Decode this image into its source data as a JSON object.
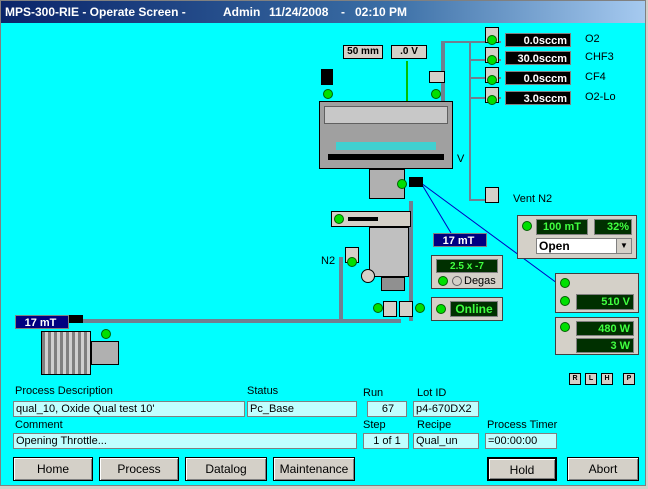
{
  "window": {
    "title_app": "MPS-300-RIE - Operate Screen -",
    "title_user": "Admin",
    "title_date": "11/24/2008",
    "title_sep": "-",
    "title_time": "02:10 PM"
  },
  "chamber": {
    "gap_value": "50 mm",
    "voltage_value": ".0 V",
    "side_label": "V",
    "pressure_readout": "17 mT",
    "n2_label": "N2",
    "pump_pressure": "17 mT"
  },
  "gases": [
    {
      "flow": "0.0sccm",
      "name": "O2"
    },
    {
      "flow": "30.0sccm",
      "name": "CHF3"
    },
    {
      "flow": "0.0sccm",
      "name": "CF4"
    },
    {
      "flow": "3.0sccm",
      "name": "O2-Lo"
    }
  ],
  "vent": {
    "label": "Vent N2"
  },
  "throttle": {
    "pressure": "100 mT",
    "percent": "32%",
    "mode": "Open"
  },
  "degas": {
    "value": "2.5 x -7",
    "label": "Degas"
  },
  "pump_status": {
    "label": "Online"
  },
  "rf": {
    "dc_bias": "510 V",
    "forward": "480 W",
    "reflected": "3 W"
  },
  "small_buttons": [
    "R",
    "L",
    "H",
    "P"
  ],
  "info": {
    "process_description_label": "Process Description",
    "process_description": "qual_10, Oxide Qual test 10'",
    "status_label": "Status",
    "status": "Pc_Base",
    "run_label": "Run",
    "run": "67",
    "lot_label": "Lot ID",
    "lot": "p4-670DX2",
    "comment_label": "Comment",
    "comment": "Opening Throttle...",
    "step_label": "Step",
    "step": "1 of 1",
    "recipe_label": "Recipe",
    "recipe": "Qual_un",
    "timer_label": "Process Timer",
    "timer": "=00:00:00"
  },
  "buttons": {
    "home": "Home",
    "process": "Process",
    "datalog": "Datalog",
    "maintenance": "Maintenance",
    "hold": "Hold",
    "abort": "Abort"
  },
  "colors": {
    "background": "#00ffff",
    "led_on": "#00e000",
    "titlebar": "#0a246a"
  }
}
